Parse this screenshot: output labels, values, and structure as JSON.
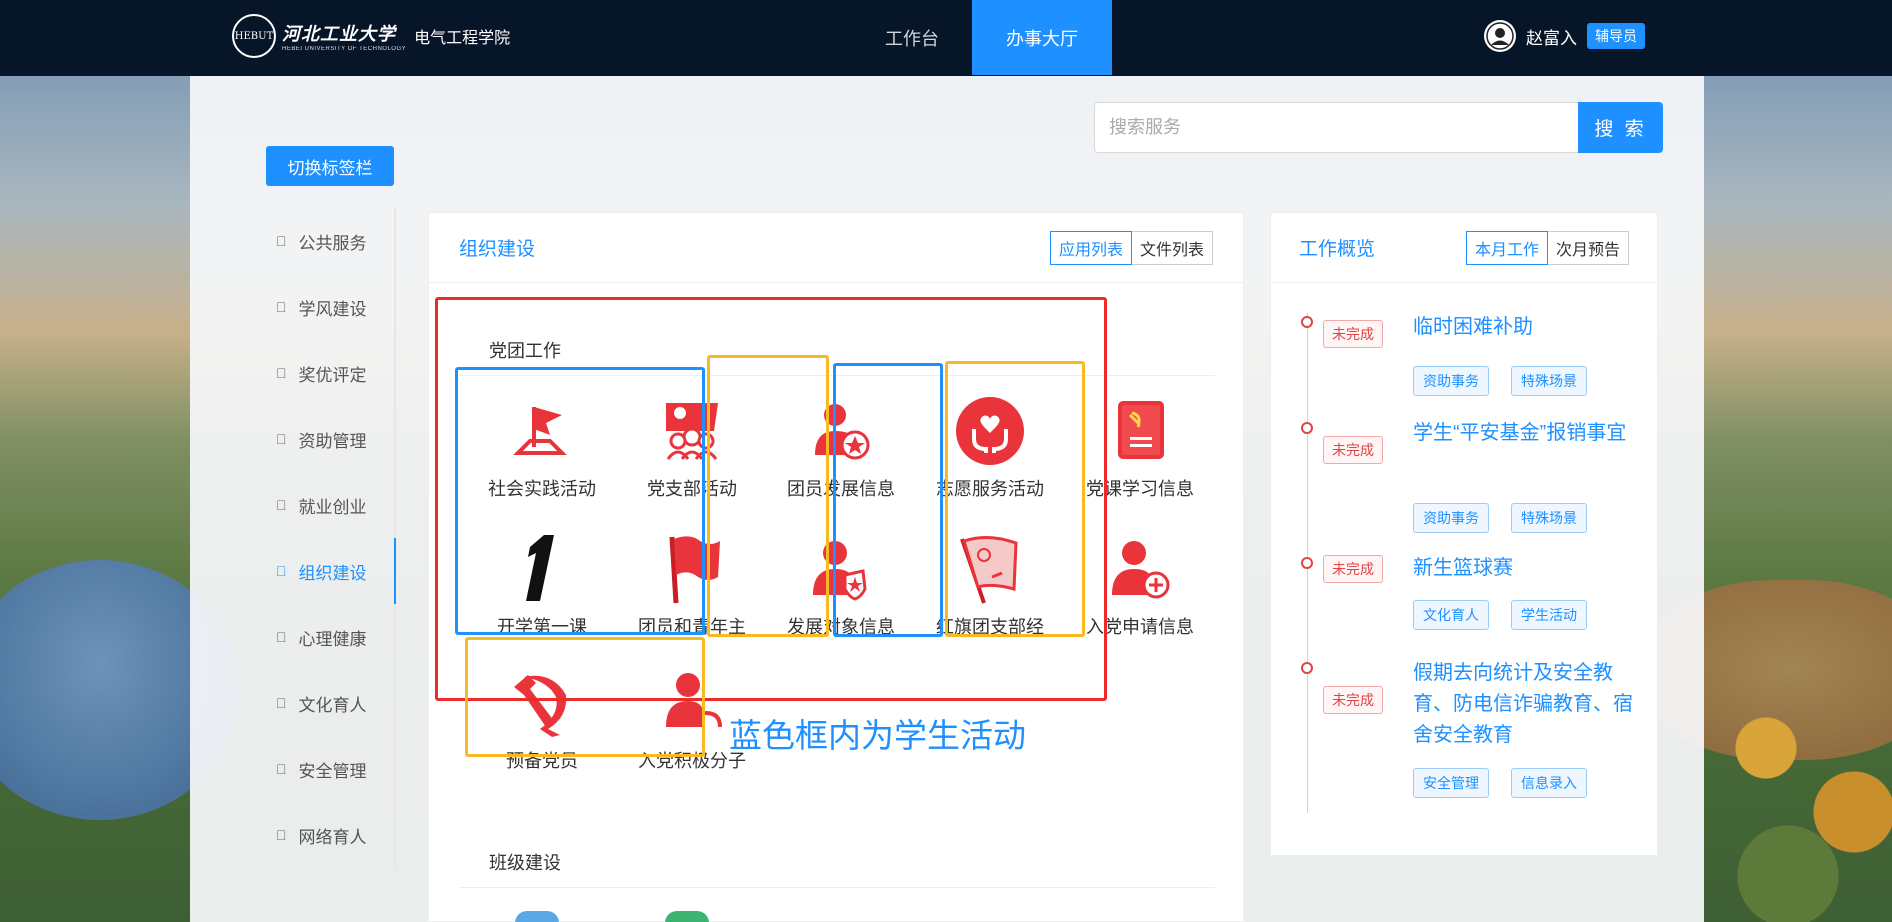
{
  "header": {
    "school_name": "河北工业大学",
    "school_en": "HEBEI UNIVERSITY OF TECHNOLOGY",
    "college": "电气工程学院",
    "tabs": [
      "工作台",
      "办事大厅"
    ],
    "active_tab": "办事大厅",
    "user_name": "赵富入",
    "user_role": "辅导员"
  },
  "search": {
    "placeholder": "搜索服务",
    "button": "搜 索"
  },
  "switch_button": "切换标签栏",
  "sidebar": {
    "items": [
      {
        "label": "公共服务"
      },
      {
        "label": "学风建设"
      },
      {
        "label": "奖优评定"
      },
      {
        "label": "资助管理"
      },
      {
        "label": "就业创业"
      },
      {
        "label": "组织建设",
        "active": true
      },
      {
        "label": "心理健康"
      },
      {
        "label": "文化育人"
      },
      {
        "label": "安全管理"
      },
      {
        "label": "网络育人"
      }
    ]
  },
  "center": {
    "title": "组织建设",
    "segments": [
      "应用列表",
      "文件列表"
    ],
    "section1": "党团工作",
    "section2": "班级建设",
    "apps": [
      {
        "label": "社会实践活动",
        "icon": "flag-stand-icon"
      },
      {
        "label": "党支部活动",
        "icon": "group-flag-icon"
      },
      {
        "label": "团员发展信息",
        "icon": "member-star-icon"
      },
      {
        "label": "志愿服务活动",
        "icon": "volunteer-heart-icon"
      },
      {
        "label": "党课学习信息",
        "icon": "party-book-icon"
      },
      {
        "label": "开学第一课",
        "icon": "number-one-icon"
      },
      {
        "label": "团员和青年主",
        "icon": "red-flag-icon"
      },
      {
        "label": "发展对象信息",
        "icon": "member-shield-icon"
      },
      {
        "label": "红旗团支部经",
        "icon": "red-banner-icon"
      },
      {
        "label": "入党申请信息",
        "icon": "member-add-icon"
      },
      {
        "label": "预备党员",
        "icon": "hammer-sickle-icon"
      },
      {
        "label": "入党积极分子",
        "icon": "member-return-icon"
      }
    ],
    "annotation": "蓝色框内为学生活动"
  },
  "overview": {
    "title": "工作概览",
    "segments": [
      "本月工作",
      "次月预告"
    ],
    "tasks": [
      {
        "status": "未完成",
        "title": "临时困难补助",
        "tags": [
          "资助事务",
          "特殊场景"
        ]
      },
      {
        "status": "未完成",
        "title": "学生“平安基金”报销事宜",
        "tags": [
          "资助事务",
          "特殊场景"
        ]
      },
      {
        "status": "未完成",
        "title": "新生篮球赛",
        "tags": [
          "文化育人",
          "学生活动"
        ]
      },
      {
        "status": "未完成",
        "title": "假期去向统计及安全教育、防电信诈骗教育、宿舍安全教育",
        "tags": [
          "安全管理",
          "信息录入"
        ]
      }
    ]
  },
  "colors": {
    "accent": "#1e90ff",
    "header_bg": "#071528",
    "icon_red": "#e8343a",
    "status_red": "#e04444"
  }
}
